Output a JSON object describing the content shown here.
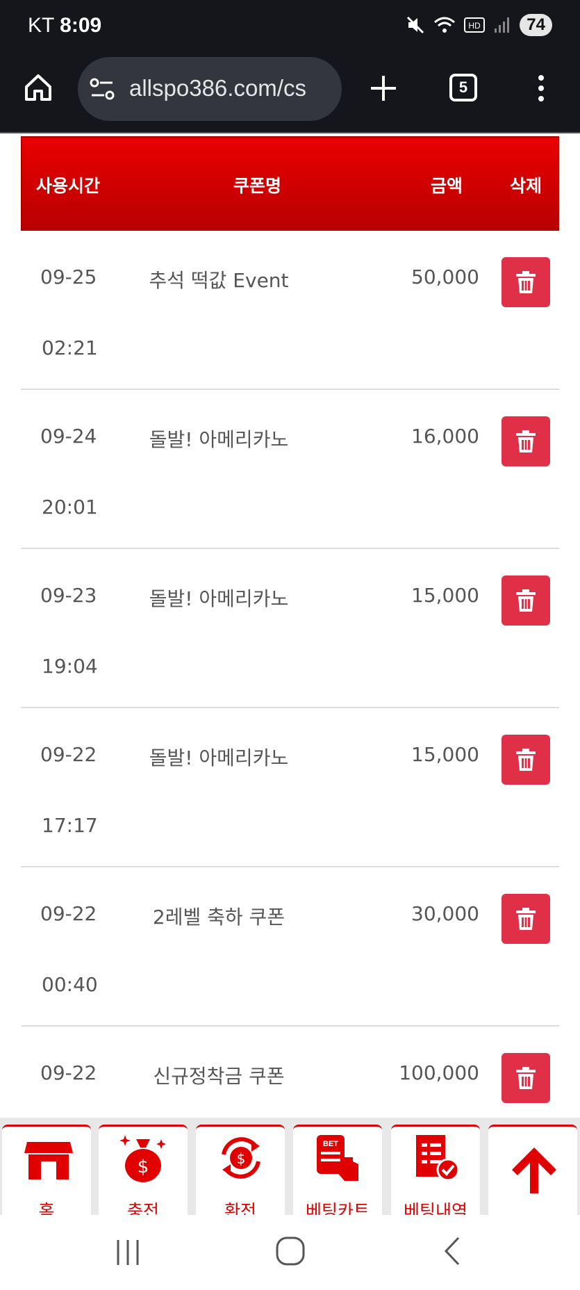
{
  "status_bar": {
    "carrier": "KT",
    "time": "8:09",
    "battery": "74"
  },
  "browser": {
    "url": "allspo386.com/cs",
    "tab_count": "5"
  },
  "table": {
    "headers": {
      "time": "사용시간",
      "coupon": "쿠폰명",
      "amount": "금액",
      "delete": "삭제"
    },
    "rows": [
      {
        "date": "09-25",
        "time": "02:21",
        "coupon": "추석 떡값 Event",
        "amount": "50,000"
      },
      {
        "date": "09-24",
        "time": "20:01",
        "coupon": "돌발! 아메리카노",
        "amount": "16,000"
      },
      {
        "date": "09-23",
        "time": "19:04",
        "coupon": "돌발! 아메리카노",
        "amount": "15,000"
      },
      {
        "date": "09-22",
        "time": "17:17",
        "coupon": "돌발! 아메리카노",
        "amount": "15,000"
      },
      {
        "date": "09-22",
        "time": "00:40",
        "coupon": "2레벨 축하 쿠폰",
        "amount": "30,000"
      },
      {
        "date": "09-22",
        "time": "",
        "coupon": "신규정착금 쿠폰",
        "amount": "100,000"
      }
    ]
  },
  "bottom_nav": {
    "items": [
      {
        "label": "홈",
        "icon": "store-icon"
      },
      {
        "label": "충전",
        "icon": "money-bag-icon"
      },
      {
        "label": "환전",
        "icon": "exchange-icon"
      },
      {
        "label": "베팅카트",
        "icon": "bet-cart-icon"
      },
      {
        "label": "베팅내역",
        "icon": "bet-history-icon"
      },
      {
        "label": "",
        "icon": "arrow-up-icon"
      }
    ]
  },
  "colors": {
    "accent": "#e00000",
    "delete": "#e03047",
    "header_top": "#ea0000",
    "header_bottom": "#b80000"
  }
}
